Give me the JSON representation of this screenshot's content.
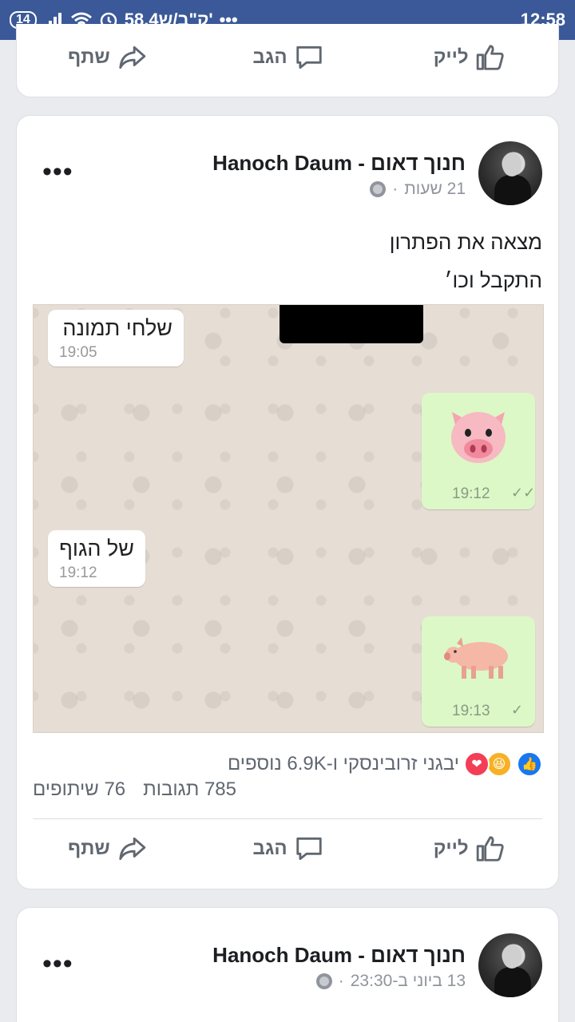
{
  "status_bar": {
    "battery": "14",
    "left_text": "58.4ק\"ב/ש'",
    "more": "•••",
    "time": "12:58"
  },
  "actions": {
    "like": "לייק",
    "comment": "הגב",
    "share": "שתף"
  },
  "post": {
    "author": "חנוך דאום - Hanoch Daum",
    "time": "21 שעות",
    "text_line1": "מצאה את הפתרון",
    "text_line2": "התקבל וכו׳",
    "chat": {
      "msg1": "שלחי תמונה",
      "msg1_time": "19:05",
      "msg2_time": "19:12",
      "msg3": "של הגוף",
      "msg3_time": "19:12",
      "msg4_time": "19:13"
    },
    "reactions_text": "יבגני זרובינסקי ו-6.9K נוספים",
    "comments_count": "785 תגובות",
    "shares_count": "76 שיתופים"
  },
  "next_post": {
    "author": "חנוך דאום - Hanoch Daum",
    "time": "13 ביוני ב-23:30"
  },
  "colors": {
    "brand": "#3b5998",
    "like_blue": "#1877f2",
    "chat_bg": "#e6ddd4",
    "chat_out": "#dcf8c6"
  }
}
